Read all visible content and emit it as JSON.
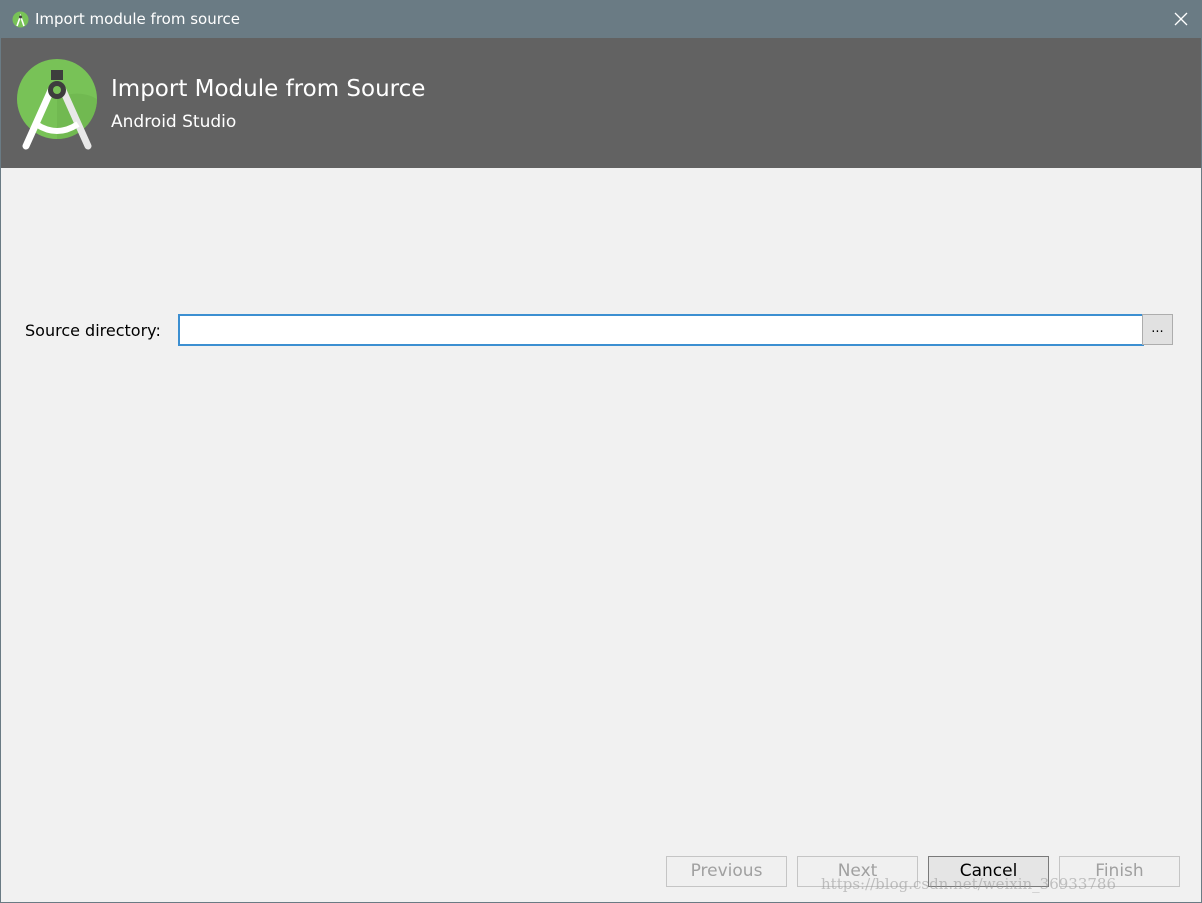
{
  "window": {
    "title": "Import module from source",
    "close_icon": "close-icon",
    "app_icon": "android-studio-icon"
  },
  "banner": {
    "heading": "Import Module from Source",
    "subheading": "Android Studio",
    "logo": "android-studio-logo"
  },
  "form": {
    "source_label": "Source directory:",
    "source_value": "",
    "browse_label": "..."
  },
  "buttons": {
    "previous": "Previous",
    "next": "Next",
    "cancel": "Cancel",
    "finish": "Finish"
  },
  "watermark": "https://blog.csdn.net/weixin_36933786",
  "colors": {
    "titlebar": "#6a7b84",
    "banner": "#626262",
    "input_focus": "#3c8fd1",
    "logo_green": "#78c257"
  }
}
